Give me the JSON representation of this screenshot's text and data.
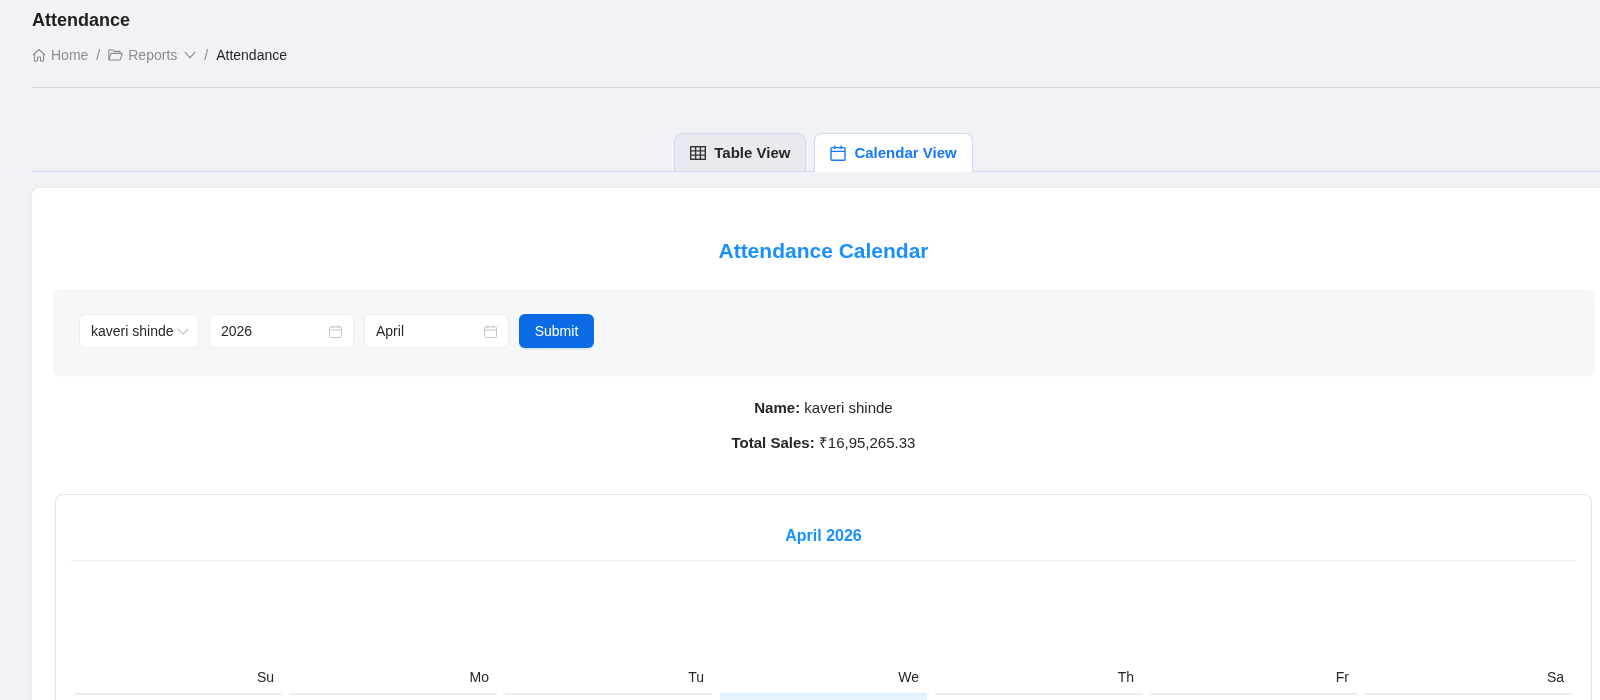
{
  "page": {
    "title": "Attendance"
  },
  "breadcrumb": [
    {
      "label": "Home",
      "kind": "home",
      "separator": "/"
    },
    {
      "label": "Reports",
      "kind": "menu",
      "separator": "/"
    },
    {
      "label": "Attendance",
      "kind": "current"
    }
  ],
  "tabs": [
    {
      "label": "Table View",
      "kind": "table",
      "selected": false
    },
    {
      "label": "Calendar View",
      "kind": "calendar",
      "selected": true
    }
  ],
  "card": {
    "title": "Attendance Calendar",
    "filters": [
      {
        "kind": "select",
        "value": "kaveri shinde"
      },
      {
        "kind": "date",
        "value": "2026"
      },
      {
        "kind": "date",
        "value": "April"
      }
    ],
    "submit": "Submit",
    "summary": [
      "**Name:** kaveri shinde",
      "**Total Sales:** ₹16,95,265.33"
    ],
    "calendar": {
      "title": "April 2026",
      "weekdays": [
        "Su",
        "Mo",
        "Tu",
        "We",
        "Th",
        "Fr",
        "Sa"
      ],
      "first_week": [
        {
          "selected": false
        },
        {
          "selected": false
        },
        {
          "selected": false
        },
        {
          "selected": true
        },
        {
          "selected": false
        },
        {
          "selected": false
        },
        {
          "selected": false
        }
      ]
    }
  }
}
